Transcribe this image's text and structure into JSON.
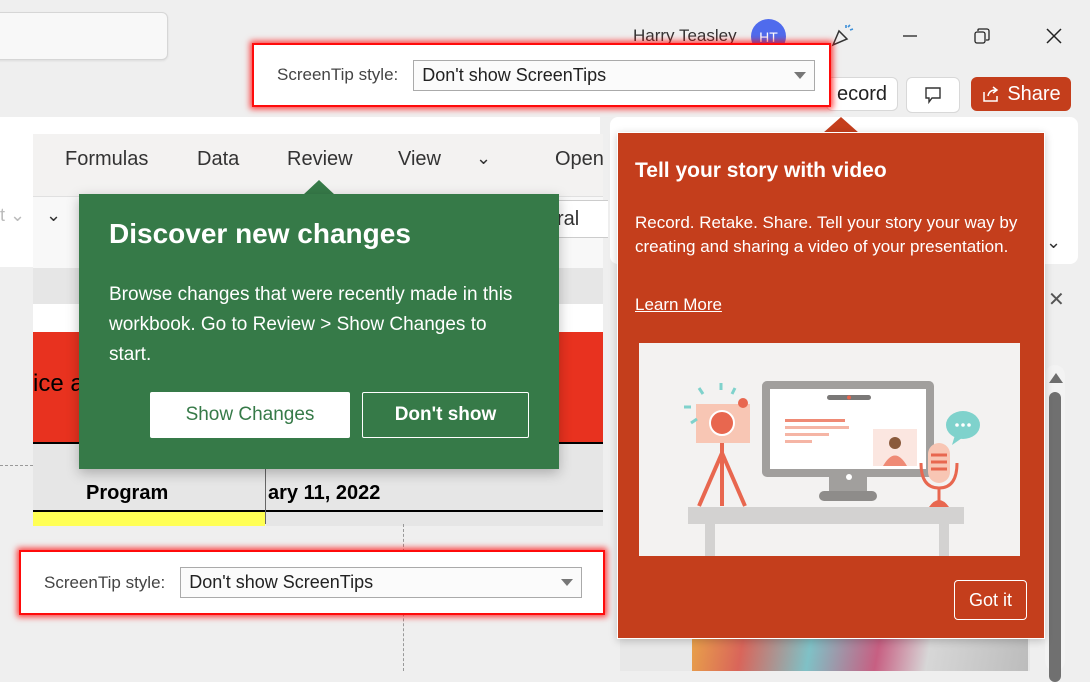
{
  "titlebar": {
    "user_name": "Harry Teasley",
    "avatar_initials": "HT",
    "icons": [
      "celebrate-icon",
      "minimize-icon",
      "restore-icon",
      "close-icon"
    ],
    "record_label": "Record",
    "record_visible_label": "ecord",
    "share_label": "Share",
    "accent_color": "#c43e1c"
  },
  "ribbon": {
    "tabs": [
      "Formulas",
      "Data",
      "Review",
      "View"
    ],
    "open_label_partial": "Open",
    "number_format_partial": "ral",
    "left_partial": "t"
  },
  "sheet": {
    "red_header_partial": "ice a",
    "program_label": "Program",
    "date_partial": "ary 11, 2022"
  },
  "screentip_top": {
    "label": "ScreenTip style:",
    "value": "Don't show ScreenTips"
  },
  "screentip_bottom": {
    "label": "ScreenTip style:",
    "value": "Don't show ScreenTips"
  },
  "excel_callout": {
    "title": "Discover new changes",
    "body": "Browse changes that were recently made in this workbook. Go to Review > Show Changes to start.",
    "primary_button": "Show Changes",
    "secondary_button": "Don't show",
    "color": "#367a48"
  },
  "ppt_callout": {
    "title": "Tell your story with video",
    "body": "Record. Retake. Share. Tell your story your way by creating and sharing a video of your presentation.",
    "link": "Learn More",
    "button": "Got it",
    "illustration": "video-recording-desk-illustration",
    "color": "#c43e1c"
  }
}
